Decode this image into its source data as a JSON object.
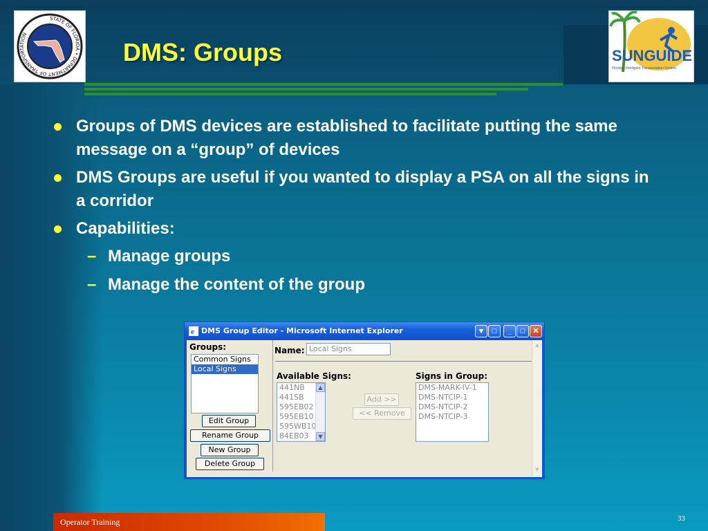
{
  "slide": {
    "title": "DMS: Groups",
    "bullets": [
      "Groups of DMS devices are established to facilitate putting the same message on a “group” of devices",
      "DMS Groups are useful if you wanted to display a PSA on all the signs in a corridor",
      "Capabilities:"
    ],
    "sub_bullets": [
      "Manage groups",
      "Manage the content of the group"
    ],
    "footer": "Operator Training",
    "page_number": "33"
  },
  "logos": {
    "fdot": {
      "text_ring": "STATE OF FLORIDA • DEPARTMENT OF TRANSPORTATION"
    },
    "sunguide": {
      "wordmark": "SUNGUIDE",
      "tagline": "Florida's Intelligent Transportation System",
      "sm": "SM"
    }
  },
  "window": {
    "title": "DMS Group Editor - Microsoft Internet Explorer",
    "groups_label": "Groups:",
    "groups": [
      "Common Signs",
      "Local Signs"
    ],
    "selected_group": "Local Signs",
    "buttons": {
      "edit_group": "Edit Group",
      "rename_group": "Rename Group",
      "new_group": "New Group",
      "delete_group": "Delete Group",
      "add": "Add >>",
      "remove": "<< Remove"
    },
    "name_label": "Name:",
    "name_value": "Local Signs",
    "available_label": "Available Signs:",
    "available_signs": [
      "441NB",
      "441SB",
      "595EB02",
      "595EB10",
      "595WB10",
      "84EB03"
    ],
    "in_group_label": "Signs in Group:",
    "signs_in_group": [
      "DMS-MARK-IV-1",
      "DMS-NTCIP-1",
      "DMS-NTCIP-2",
      "DMS-NTCIP-3"
    ]
  },
  "colors": {
    "title": "#ffff33",
    "bullet_dot": "#ffff33",
    "footer": "#e04a00",
    "selection": "#316ac5"
  }
}
